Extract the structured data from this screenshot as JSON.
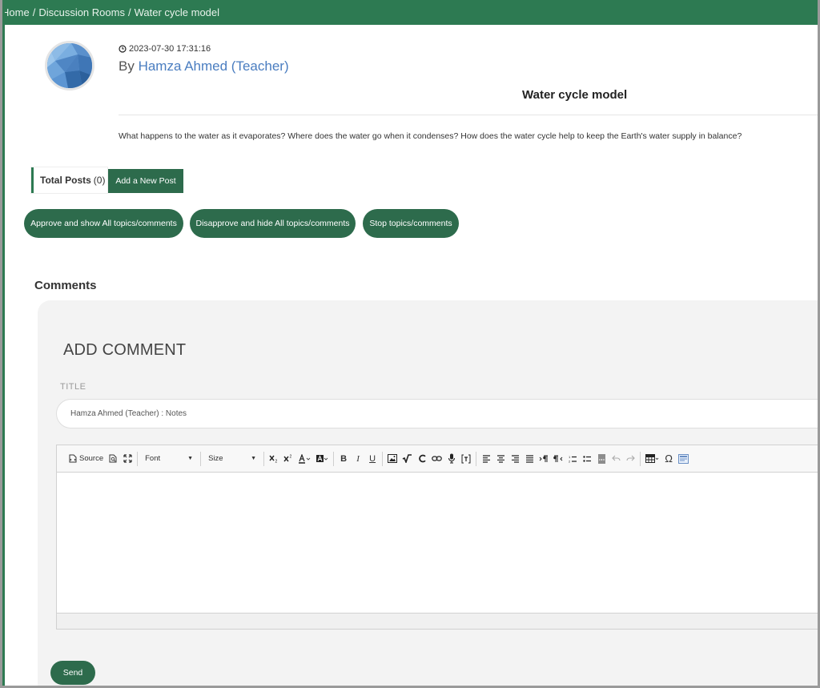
{
  "breadcrumb": {
    "home": "Home",
    "rooms": "Discussion Rooms",
    "current": "Water cycle model",
    "separator": "/"
  },
  "post": {
    "timestamp": "2023-07-30 17:31:16",
    "by_prefix": "By",
    "author": "Hamza Ahmed (Teacher)",
    "title": "Water cycle model",
    "body": "What happens to the water as it evaporates? Where does the water go when it condenses? How does the water cycle help to keep the Earth's water supply in balance?"
  },
  "stats": {
    "total_posts_label": "Total Posts",
    "total_posts_count": "(0)",
    "add_post_label": "Add a New Post"
  },
  "actions": {
    "approve_label": "Approve and show All topics/comments",
    "disapprove_label": "Disapprove and hide All topics/comments",
    "stop_label": "Stop topics/comments"
  },
  "comments": {
    "heading": "Comments",
    "add_heading": "ADD COMMENT",
    "title_label": "TITLE",
    "title_value": "Hamza Ahmed (Teacher) : Notes",
    "send_label": "Send"
  },
  "editor": {
    "source_label": "Source",
    "font_label": "Font",
    "size_label": "Size",
    "bold_label": "B",
    "italic_label": "I",
    "underline_label": "U",
    "omega_label": "Ω"
  },
  "colors": {
    "brand_green": "#2d7a52",
    "button_green": "#2d6b4c",
    "author_link": "#4a7dc0"
  }
}
